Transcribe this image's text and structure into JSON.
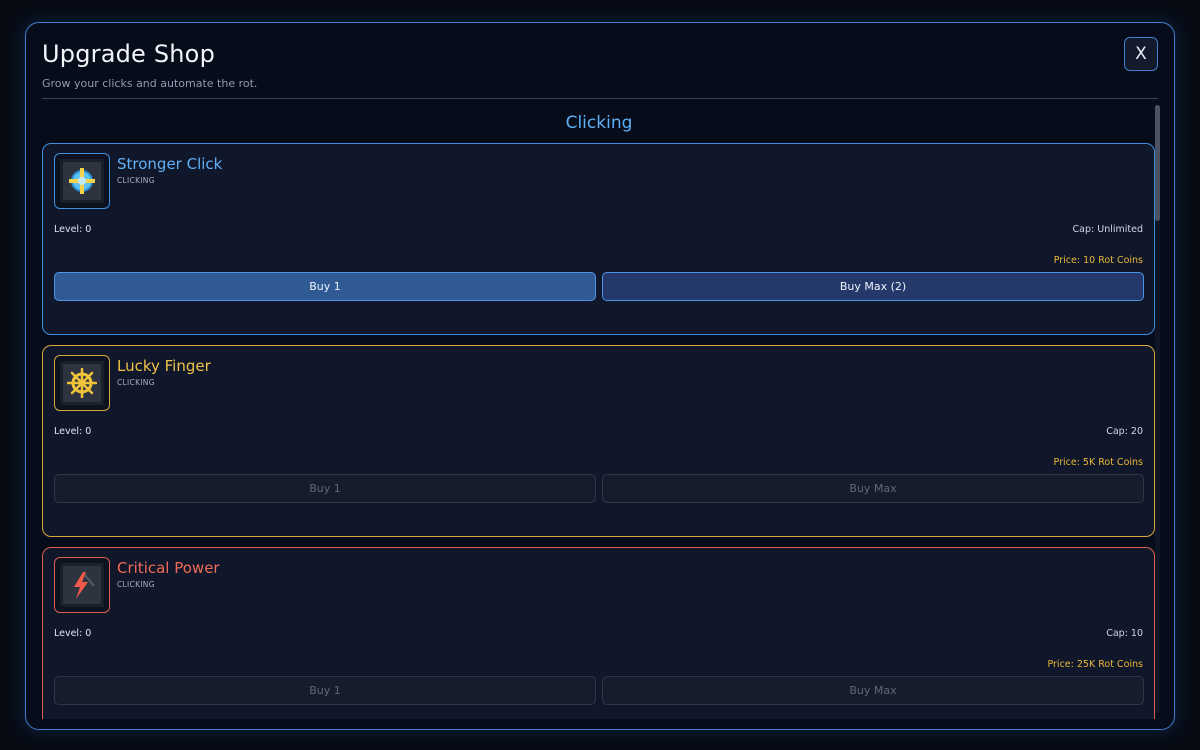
{
  "shop": {
    "title": "Upgrade Shop",
    "subtitle": "Grow your clicks and automate the rot.",
    "close_label": "X"
  },
  "section": {
    "title": "Clicking"
  },
  "upgrades": [
    {
      "name": "Stronger Click",
      "category": "CLICKING",
      "level": "Level: 0",
      "cap": "Cap: Unlimited",
      "price": "Price: 10 Rot Coins",
      "buy1_label": "Buy 1",
      "buymax_label": "Buy Max (2)",
      "icon": "crosshair-gem-icon",
      "accent": "#3f8fe0",
      "enabled": true
    },
    {
      "name": "Lucky Finger",
      "category": "CLICKING",
      "level": "Level: 0",
      "cap": "Cap: 20",
      "price": "Price: 5K Rot Coins",
      "buy1_label": "Buy 1",
      "buymax_label": "Buy Max",
      "icon": "ship-wheel-icon",
      "accent": "#d8a73a",
      "enabled": false
    },
    {
      "name": "Critical Power",
      "category": "CLICKING",
      "level": "Level: 0",
      "cap": "Cap: 10",
      "price": "Price: 25K Rot Coins",
      "buy1_label": "Buy 1",
      "buymax_label": "Buy Max",
      "icon": "lightning-bolt-icon",
      "accent": "#d9604e",
      "enabled": false
    }
  ]
}
